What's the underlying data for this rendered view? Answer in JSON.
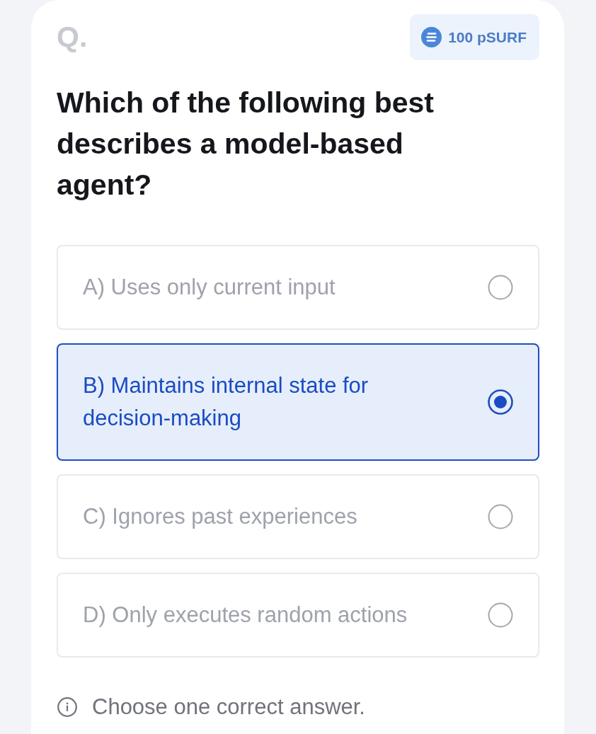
{
  "header": {
    "label": "Q.",
    "reward": {
      "amount": "100 pSURF"
    }
  },
  "question": "Which of the following best describes a model-based agent?",
  "options": [
    {
      "label": "A) Uses only current input",
      "selected": false
    },
    {
      "label": "B) Maintains internal state for decision-making",
      "selected": true
    },
    {
      "label": "C) Ignores past experiences",
      "selected": false
    },
    {
      "label": "D) Only executes random actions",
      "selected": false
    }
  ],
  "hint": "Choose one correct answer."
}
